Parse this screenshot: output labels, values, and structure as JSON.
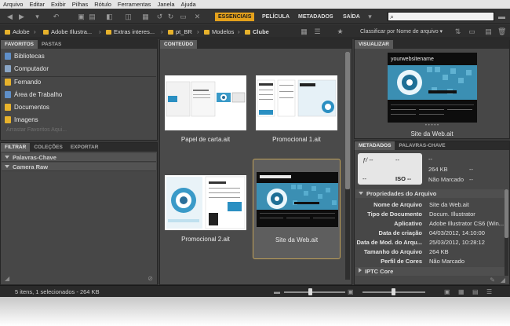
{
  "menu": [
    "Arquivo",
    "Editar",
    "Exibir",
    "Pilhas",
    "Rótulo",
    "Ferramentas",
    "Janela",
    "Ajuda"
  ],
  "workspaces": [
    {
      "label": "ESSENCIAIS",
      "active": true
    },
    {
      "label": "PELÍCULA"
    },
    {
      "label": "METADADOS"
    },
    {
      "label": "SAÍDA"
    }
  ],
  "search": {
    "value": "",
    "mag": "⌕"
  },
  "path": [
    "Adobe",
    "Adobe Illustra...",
    "Extras interes...",
    "pt_BR",
    "Modelos",
    "Clube"
  ],
  "sort_label": "Classificar por Nome de arquivo",
  "favorites": {
    "tabs": [
      "FAVORITOS",
      "PASTAS"
    ],
    "items": [
      {
        "label": "Bibliotecas",
        "icon": "libraries-icon",
        "color": "#5f8fc8"
      },
      {
        "label": "Computador",
        "icon": "computer-icon",
        "color": "#8aa6c6"
      },
      {
        "label": "Fernando",
        "icon": "folder-icon",
        "color": "#e7b22c"
      },
      {
        "label": "Área de Trabalho",
        "icon": "desktop-icon",
        "color": "#5f8fc8"
      },
      {
        "label": "Documentos",
        "icon": "documents-icon",
        "color": "#e7b22c"
      },
      {
        "label": "Imagens",
        "icon": "images-icon",
        "color": "#e7b22c"
      }
    ],
    "hint": "Arrastar Favoritos Aqui..."
  },
  "filter": {
    "tabs": [
      "FILTRAR",
      "COLEÇÕES",
      "EXPORTAR"
    ],
    "rows": [
      "Palavras-Chave",
      "Camera Raw"
    ]
  },
  "content": {
    "tab": "CONTEÚDO",
    "items": [
      {
        "caption": "Papel de carta.ait"
      },
      {
        "caption": "Promocional 1.ait"
      },
      {
        "caption": "Promocional 2.ait"
      },
      {
        "caption": "Site da Web.ait",
        "selected": true
      }
    ]
  },
  "preview": {
    "tab": "VISUALIZAR",
    "site_title": "yourwebsitename",
    "caption": "Site da Web.ait"
  },
  "metadata": {
    "tabs": [
      "METADADOS",
      "PALAVRAS-CHAVE"
    ],
    "camera": {
      "fstop": "ƒ/ --",
      "dash1": "--",
      "dash2": "--",
      "iso": "ISO --"
    },
    "summary": {
      "dash": "--",
      "size": "264 KB",
      "rating": "Não Marcado",
      "dash2": "--",
      "dash3": "--"
    },
    "section": "Propriedades do Arquivo",
    "rows": [
      {
        "key": "Nome de Arquivo",
        "value": "Site da Web.ait"
      },
      {
        "key": "Tipo de Documento",
        "value": "Docum. Illustrator"
      },
      {
        "key": "Aplicativo",
        "value": "Adobe Illustrator CS6 (Win..."
      },
      {
        "key": "Data de criação",
        "value": "04/03/2012, 14:10:00"
      },
      {
        "key": "Data de Mod. do Arqu...",
        "value": "25/03/2012, 10:28:12"
      },
      {
        "key": "Tamanho do Arquivo",
        "value": "264 KB"
      },
      {
        "key": "Perfil de Cores",
        "value": "Não Marcado"
      }
    ],
    "section2": "IPTC Core"
  },
  "status": "5 itens, 1 selecionados - 264 KB"
}
